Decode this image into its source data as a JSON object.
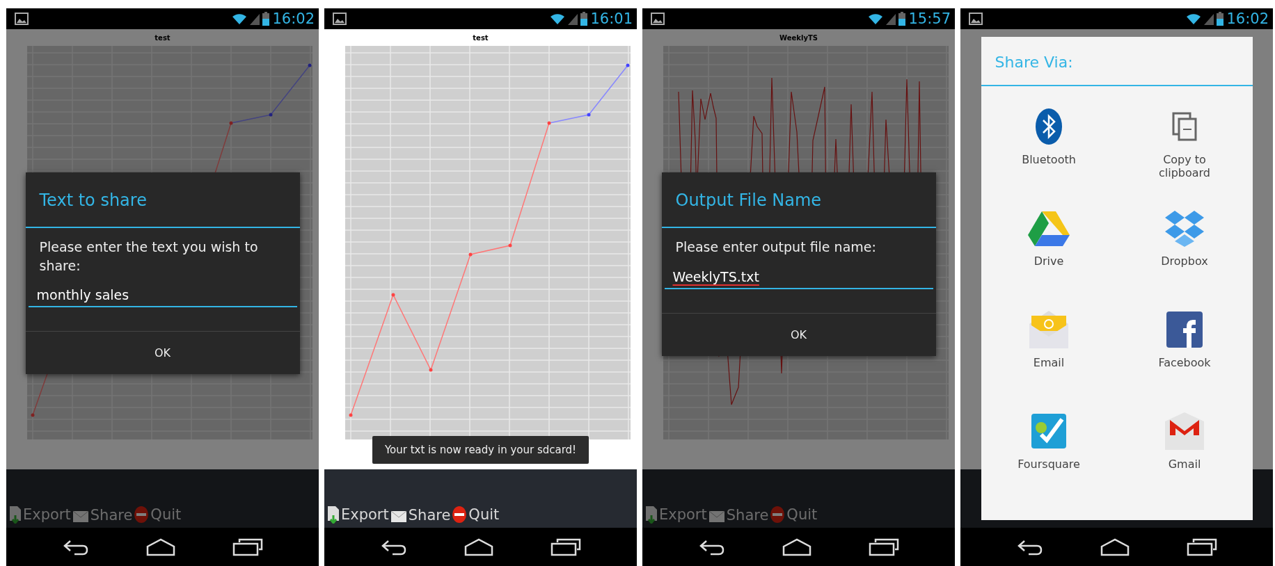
{
  "screens": [
    {
      "kind": "text_dialog",
      "time": "16:02",
      "chart": {
        "title": "test",
        "kind": "line"
      },
      "dialog": {
        "title": "Text to share",
        "message": "Please enter the text you wish to share:",
        "value": "monthly sales",
        "misspelled": false,
        "button": "OK"
      },
      "actions": [
        {
          "label": "Export",
          "kind": "export"
        },
        {
          "label": "Share",
          "kind": "share"
        },
        {
          "label": "Quit",
          "kind": "quit"
        }
      ]
    },
    {
      "kind": "toast",
      "time": "16:01",
      "chart": {
        "title": "test",
        "kind": "line"
      },
      "toast": "Your txt is now ready in your sdcard!",
      "actions": [
        {
          "label": "Export",
          "kind": "export"
        },
        {
          "label": "Share",
          "kind": "share"
        },
        {
          "label": "Quit",
          "kind": "quit"
        }
      ]
    },
    {
      "kind": "text_dialog",
      "time": "15:57",
      "chart": {
        "title": "WeeklyTS",
        "kind": "spikes"
      },
      "dialog": {
        "title": "Output File Name",
        "message": "Please enter output file name:",
        "value": "WeeklyTS.txt",
        "misspelled": true,
        "button": "OK"
      },
      "actions": [
        {
          "label": "Export",
          "kind": "export"
        },
        {
          "label": "Share",
          "kind": "share"
        },
        {
          "label": "Quit",
          "kind": "quit"
        }
      ]
    },
    {
      "kind": "share_dialog",
      "time": "16:02",
      "share": {
        "title": "Share Via:",
        "targets": [
          {
            "label": "Bluetooth",
            "kind": "bluetooth"
          },
          {
            "label": "Copy to clipboard",
            "kind": "clipboard"
          },
          {
            "label": "Drive",
            "kind": "drive"
          },
          {
            "label": "Dropbox",
            "kind": "dropbox"
          },
          {
            "label": "Email",
            "kind": "email"
          },
          {
            "label": "Facebook",
            "kind": "facebook"
          },
          {
            "label": "Foursquare",
            "kind": "foursquare"
          },
          {
            "label": "Gmail",
            "kind": "gmail"
          }
        ]
      }
    }
  ]
}
